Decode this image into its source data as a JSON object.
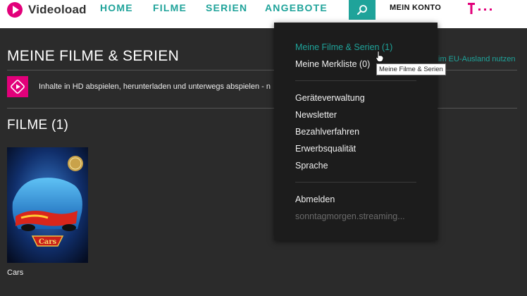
{
  "header": {
    "logo_text": "Videoload",
    "nav": [
      "HOME",
      "FILME",
      "SERIEN",
      "ANGEBOTE"
    ],
    "account_label": "MEIN KONTO"
  },
  "main": {
    "title": "MEINE FILME & SERIEN",
    "eu_link": "im EU-Ausland nutzen",
    "hd_text": "Inhalte in HD abspielen, herunterladen und unterwegs abspielen - n",
    "section_title": "FILME (1)",
    "movies": [
      {
        "title": "Cars"
      }
    ]
  },
  "dropdown": {
    "group1": [
      "Meine Filme & Serien (1)",
      "Meine Merkliste (0)"
    ],
    "group2": [
      "Geräteverwaltung",
      "Newsletter",
      "Bezahlverfahren",
      "Erwerbsqualität",
      "Sprache"
    ],
    "logout": "Abmelden",
    "user": "sonntagmorgen.streaming..."
  },
  "tooltip": "Meine Filme & Serien",
  "colors": {
    "accent": "#1fa39a",
    "brand": "#e2007a",
    "background": "#2b2b2b",
    "dropdown": "#1c1c1c"
  }
}
